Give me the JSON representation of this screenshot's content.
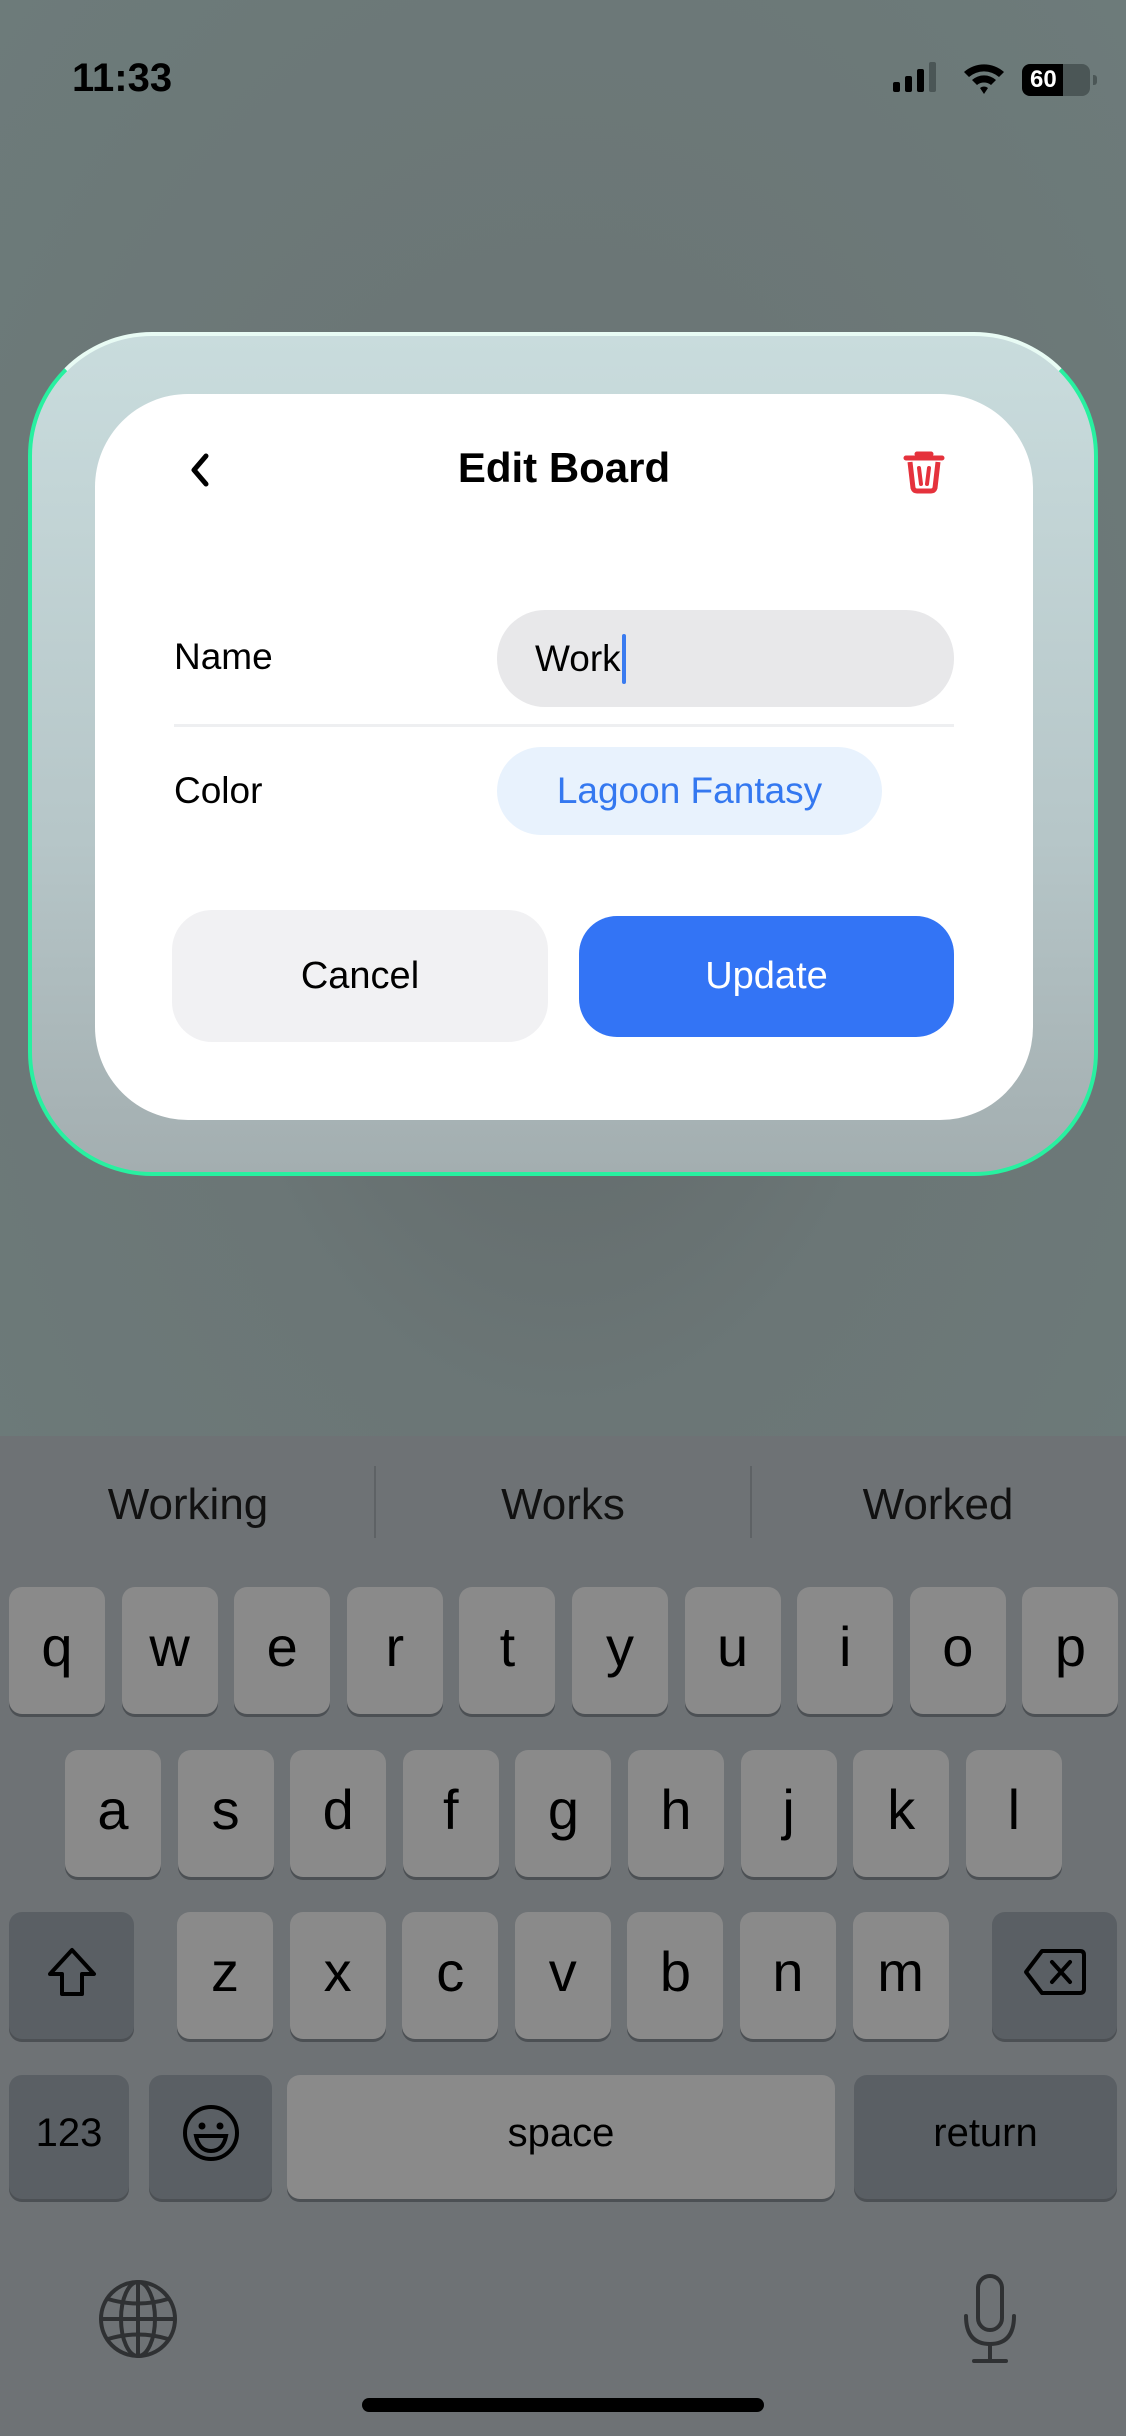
{
  "status_bar": {
    "time": "11:33",
    "battery": "60"
  },
  "dialog": {
    "title": "Edit Board",
    "back_icon": "chevron-left-icon",
    "delete_icon": "trash-icon",
    "name_label": "Name",
    "name_value": "Work",
    "color_label": "Color",
    "color_value": "Lagoon Fantasy",
    "cancel_label": "Cancel",
    "update_label": "Update",
    "colors": {
      "accent": "#3374f5",
      "delete": "#e5323c",
      "frame_border": "#28f0a0"
    }
  },
  "keyboard": {
    "suggestions": [
      "Working",
      "Works",
      "Worked"
    ],
    "row1": [
      "q",
      "w",
      "e",
      "r",
      "t",
      "y",
      "u",
      "i",
      "o",
      "p"
    ],
    "row2": [
      "a",
      "s",
      "d",
      "f",
      "g",
      "h",
      "j",
      "k",
      "l"
    ],
    "row3": [
      "z",
      "x",
      "c",
      "v",
      "b",
      "n",
      "m"
    ],
    "numbers_label": "123",
    "space_label": "space",
    "return_label": "return"
  }
}
